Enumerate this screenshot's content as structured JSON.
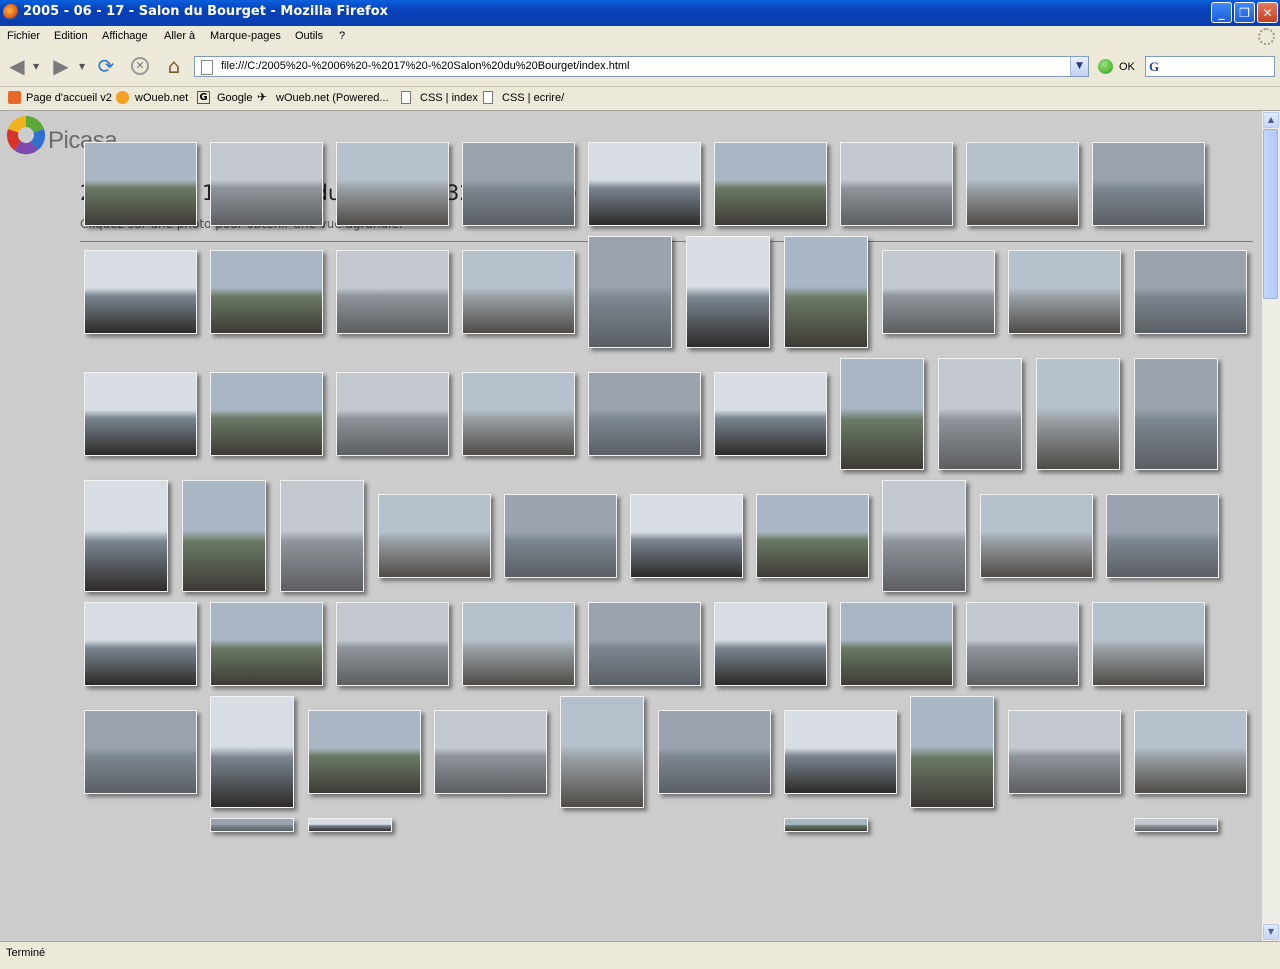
{
  "window": {
    "title": "2005 - 06 - 17 - Salon du Bourget - Mozilla Firefox"
  },
  "menu": [
    "Fichier",
    "Edition",
    "Affichage",
    "Aller à",
    "Marque-pages",
    "Outils",
    "?"
  ],
  "address": {
    "url": "file:///C:/2005%20-%2006%20-%2017%20-%20Salon%20du%20Bourget/index.html",
    "go_label": "OK"
  },
  "bookmarks": [
    "Page d'accueil v2",
    "wOueb.net",
    "Google",
    "wOueb.net (Powered...",
    "CSS | index",
    "CSS | ecrire/"
  ],
  "page": {
    "logo": "Picasa",
    "logo_tm": "TM",
    "title": "2005 - 06 - 17 - Salon du Bourget (320 images)",
    "subtitle": "Cliquez sur une photo pour obtenir une vue agrandie."
  },
  "status": {
    "text": "Terminé"
  }
}
